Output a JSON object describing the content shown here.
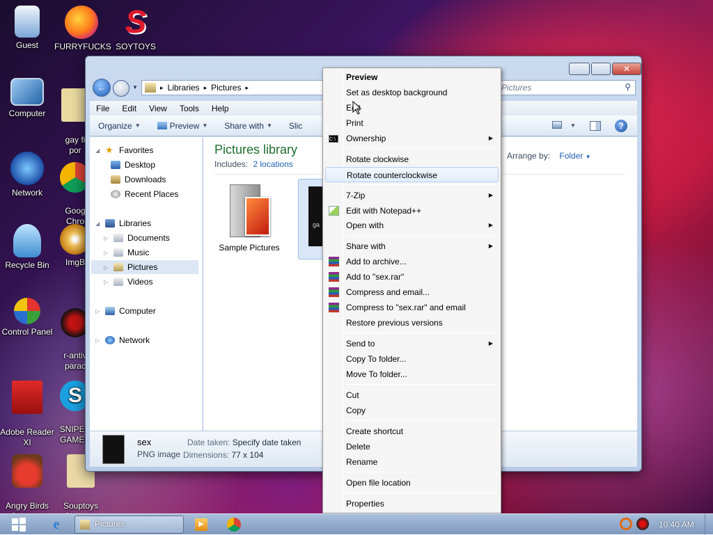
{
  "desktop": {
    "icons": [
      {
        "label": "Guest",
        "icon": "user-icon",
        "color": "#2b5fb8"
      },
      {
        "label": "FURRYFUCKS",
        "icon": "firefox-icon",
        "color": "#e8641a"
      },
      {
        "label": "SOYTOYS",
        "icon": "soytoys-s-icon",
        "color": "#d9182a"
      },
      {
        "label": "Computer",
        "icon": "computer-icon",
        "color": "#3d86c6"
      },
      {
        "label": "gay fi\npor",
        "icon": "file-icon",
        "color": "#d9a321"
      },
      {
        "label": "Network",
        "icon": "network-icon",
        "color": "#2a67c2"
      },
      {
        "label": "Goog\nChro",
        "icon": "chrome-icon",
        "color": "#db4437"
      },
      {
        "label": "Recycle Bin",
        "icon": "recycle-bin-icon",
        "color": "#6aa8d8"
      },
      {
        "label": "ImgB",
        "icon": "imgburn-icon",
        "color": "#e6a12a"
      },
      {
        "label": "Control Panel",
        "icon": "control-panel-icon",
        "color": "#3a9a3a"
      },
      {
        "label": "r-antiv\nparac",
        "icon": "antivirus-icon",
        "color": "#c21414"
      },
      {
        "label": "Adobe Reader\nXI",
        "icon": "adobe-reader-icon",
        "color": "#c61a1a"
      },
      {
        "label": "SNIPED\nGAMER",
        "icon": "skype-icon",
        "color": "#1aa0e0"
      },
      {
        "label": "Angry Birds\nSeasons",
        "icon": "angry-birds-icon",
        "color": "#d34a22"
      },
      {
        "label": "Souptoys\nPlaysets",
        "icon": "souptoys-icon",
        "color": "#d9a321"
      }
    ]
  },
  "explorer": {
    "breadcrumb": [
      "Libraries",
      "Pictures"
    ],
    "search_placeholder": "Pictures",
    "menu": [
      "File",
      "Edit",
      "View",
      "Tools",
      "Help"
    ],
    "toolbar": {
      "organize": "Organize",
      "preview": "Preview",
      "share_with": "Share with",
      "slideshow": "Slic"
    },
    "nav": {
      "favorites": "Favorites",
      "desktop": "Desktop",
      "downloads": "Downloads",
      "recent_places": "Recent Places",
      "libraries": "Libraries",
      "documents": "Documents",
      "music": "Music",
      "pictures": "Pictures",
      "videos": "Videos",
      "computer": "Computer",
      "network": "Network"
    },
    "library": {
      "title": "Pictures library",
      "includes_label": "Includes:",
      "includes_link": "2 locations",
      "arrange_label": "Arrange by:",
      "arrange_value": "Folder"
    },
    "items": [
      {
        "name": "Sample Pictures"
      },
      {
        "name": "ga"
      }
    ],
    "details": {
      "name": "sex",
      "type": "PNG image",
      "date_label": "Date taken:",
      "date_value": "Specify date taken",
      "dim_label": "Dimensions:",
      "dim_value": "77 x 104"
    }
  },
  "context_menu": {
    "preview": "Preview",
    "set_bg": "Set as desktop background",
    "edit": "Edit",
    "print": "Print",
    "ownership": "Ownership",
    "rotate_cw": "Rotate clockwise",
    "rotate_ccw": "Rotate counterclockwise",
    "zip": "7-Zip",
    "notepad": "Edit with Notepad++",
    "open_with": "Open with",
    "share_with": "Share with",
    "add_archive": "Add to archive...",
    "add_rar": "Add to \"sex.rar\"",
    "compress_email": "Compress and email...",
    "compress_rar_email": "Compress to \"sex.rar\" and email",
    "restore": "Restore previous versions",
    "send_to": "Send to",
    "copy_to": "Copy To folder...",
    "move_to": "Move To folder...",
    "cut": "Cut",
    "copy": "Copy",
    "shortcut": "Create shortcut",
    "delete": "Delete",
    "rename": "Rename",
    "open_location": "Open file location",
    "properties": "Properties"
  },
  "taskbar": {
    "active_window": "Pictures",
    "clock": "10:40 AM"
  }
}
